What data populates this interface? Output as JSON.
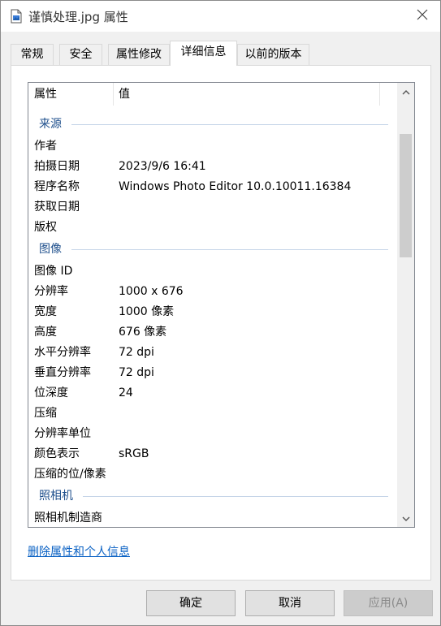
{
  "window": {
    "title": "谨慎处理.jpg 属性",
    "title_icon": "image-file-icon",
    "close_icon": "close-icon"
  },
  "tabs": [
    {
      "label": "常规",
      "active": false
    },
    {
      "label": "安全",
      "active": false
    },
    {
      "label": "属性修改",
      "active": false
    },
    {
      "label": "详细信息",
      "active": true
    },
    {
      "label": "以前的版本",
      "active": false
    }
  ],
  "list": {
    "col_property": "属性",
    "col_value": "值",
    "groups": [
      {
        "label": "来源",
        "rows": [
          {
            "name": "作者",
            "value": ""
          },
          {
            "name": "拍摄日期",
            "value": "2023/9/6 16:41"
          },
          {
            "name": "程序名称",
            "value": "Windows Photo Editor 10.0.10011.16384"
          },
          {
            "name": "获取日期",
            "value": ""
          },
          {
            "name": "版权",
            "value": ""
          }
        ]
      },
      {
        "label": "图像",
        "rows": [
          {
            "name": "图像 ID",
            "value": ""
          },
          {
            "name": "分辨率",
            "value": "1000 x 676"
          },
          {
            "name": "宽度",
            "value": "1000 像素"
          },
          {
            "name": "高度",
            "value": "676 像素"
          },
          {
            "name": "水平分辨率",
            "value": "72 dpi"
          },
          {
            "name": "垂直分辨率",
            "value": "72 dpi"
          },
          {
            "name": "位深度",
            "value": "24"
          },
          {
            "name": "压缩",
            "value": ""
          },
          {
            "name": "分辨率单位",
            "value": ""
          },
          {
            "name": "颜色表示",
            "value": "sRGB"
          },
          {
            "name": "压缩的位/像素",
            "value": ""
          }
        ]
      },
      {
        "label": "照相机",
        "rows": [
          {
            "name": "照相机制造商",
            "value": ""
          }
        ]
      }
    ]
  },
  "link_text": "删除属性和个人信息",
  "buttons": {
    "ok": "确定",
    "cancel": "取消",
    "apply": "应用(A)"
  },
  "colors": {
    "group_label": "#1e4f8c",
    "link": "#0b62c4"
  }
}
